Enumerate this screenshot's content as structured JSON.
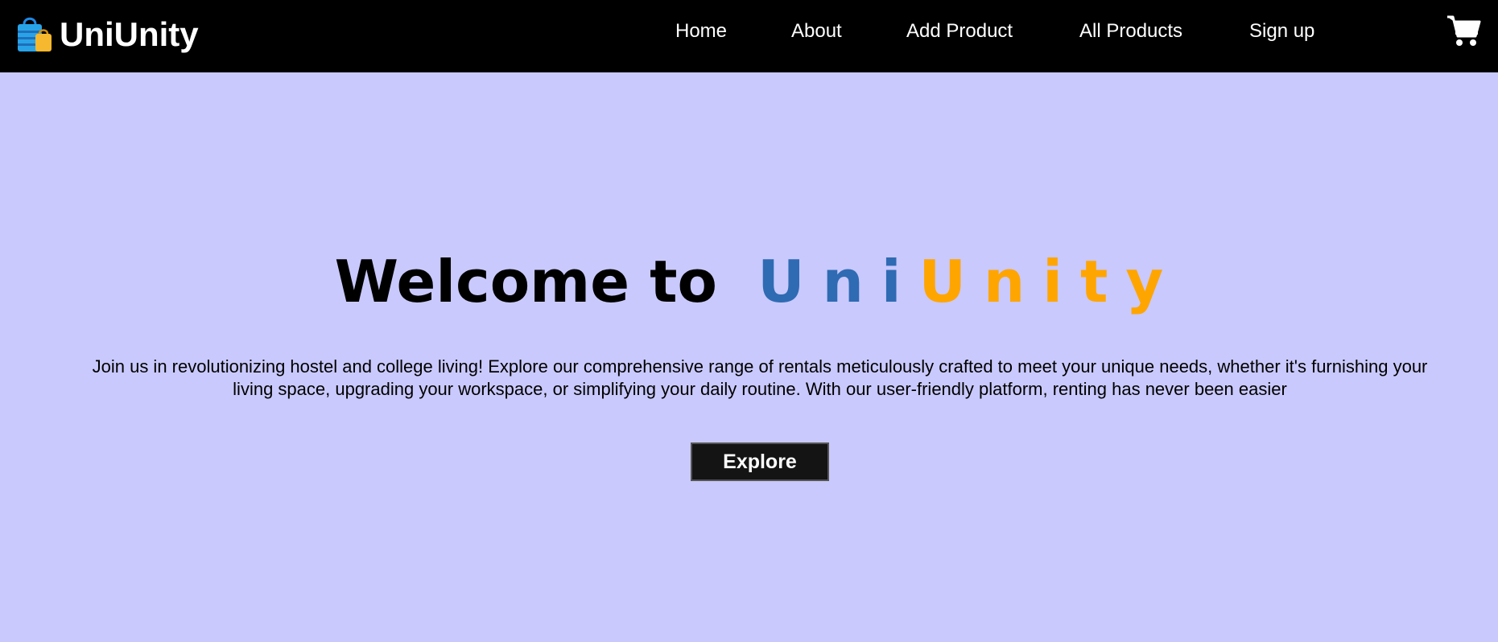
{
  "navbar": {
    "brand_name": "UniUnity",
    "brand_icon": "shopping-bag-icon",
    "links": [
      {
        "label": "Home"
      },
      {
        "label": "About"
      },
      {
        "label": "Add Product"
      },
      {
        "label": "All Products"
      },
      {
        "label": "Sign up"
      }
    ],
    "cart_icon": "shopping-cart-icon"
  },
  "hero": {
    "title_prefix": "Welcome to",
    "title_letters": [
      {
        "char": "U",
        "color": "#2f6bb3"
      },
      {
        "char": "n",
        "color": "#2f6bb3"
      },
      {
        "char": "i",
        "color": "#2f6bb3"
      },
      {
        "char": "U",
        "color": "#ffa500"
      },
      {
        "char": "n",
        "color": "#ffa500"
      },
      {
        "char": "i",
        "color": "#ffa500"
      },
      {
        "char": "t",
        "color": "#ffa500"
      },
      {
        "char": "y",
        "color": "#ffa500"
      }
    ],
    "description": "Join us in revolutionizing hostel and college living! Explore our comprehensive range of rentals meticulously crafted to meet your unique needs, whether it's furnishing your living space, upgrading your workspace, or simplifying your daily routine. With our user-friendly platform, renting has never been easier",
    "button_label": "Explore"
  },
  "colors": {
    "background": "#c9c9fd",
    "navbar": "#000000",
    "brand_blue": "#2f6bb3",
    "brand_orange": "#ffa500"
  }
}
